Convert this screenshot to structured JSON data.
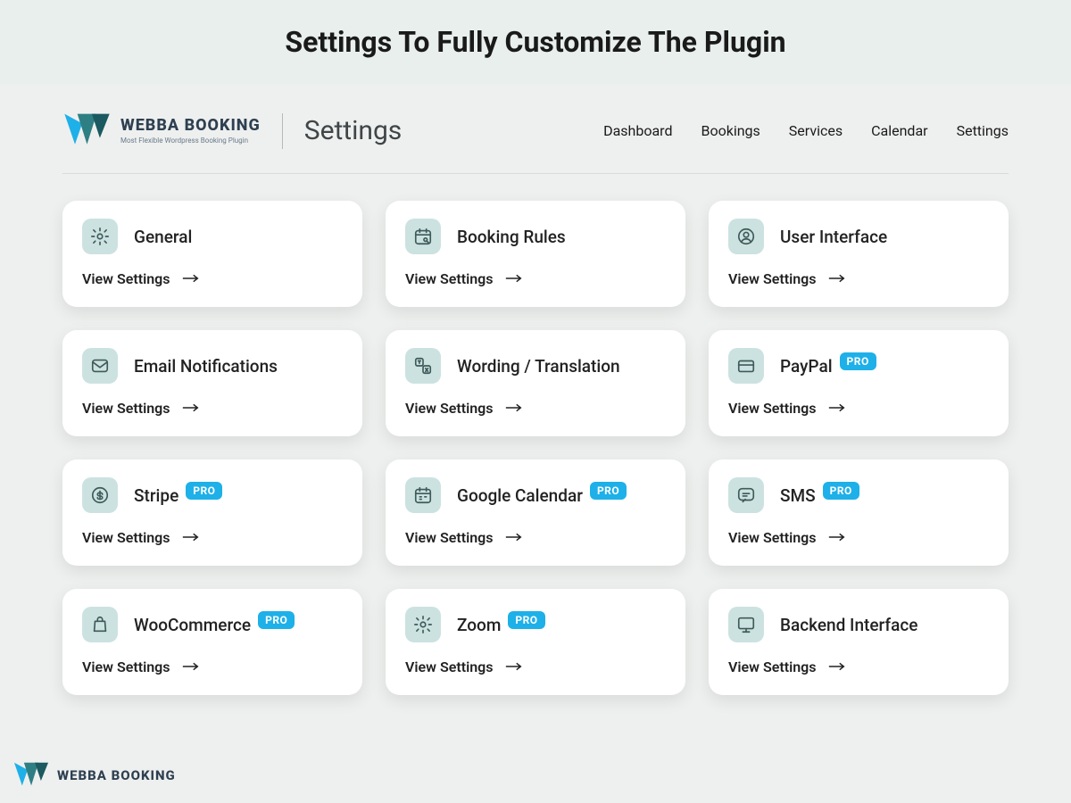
{
  "banner": {
    "title": "Settings To Fully Customize The Plugin"
  },
  "brand": {
    "name": "WEBBA BOOKING",
    "tagline": "Most Flexible Wordpress Booking Plugin"
  },
  "page": {
    "title": "Settings"
  },
  "nav": {
    "items": [
      "Dashboard",
      "Bookings",
      "Services",
      "Calendar",
      "Settings"
    ]
  },
  "pro_label": "PRO",
  "view_label": "View Settings",
  "cards": [
    {
      "title": "General",
      "icon": "gear-icon",
      "pro": false
    },
    {
      "title": "Booking Rules",
      "icon": "calendar-search-icon",
      "pro": false
    },
    {
      "title": "User Interface",
      "icon": "user-circle-icon",
      "pro": false
    },
    {
      "title": "Email Notifications",
      "icon": "mail-icon",
      "pro": false
    },
    {
      "title": "Wording / Translation",
      "icon": "translate-icon",
      "pro": false
    },
    {
      "title": "PayPal",
      "icon": "card-icon",
      "pro": true
    },
    {
      "title": "Stripe",
      "icon": "dollar-circle-icon",
      "pro": true
    },
    {
      "title": "Google Calendar",
      "icon": "calendar-icon",
      "pro": true
    },
    {
      "title": "SMS",
      "icon": "chat-icon",
      "pro": true
    },
    {
      "title": "WooCommerce",
      "icon": "bag-icon",
      "pro": true
    },
    {
      "title": "Zoom",
      "icon": "gear-icon",
      "pro": true
    },
    {
      "title": "Backend Interface",
      "icon": "monitor-icon",
      "pro": false
    }
  ]
}
